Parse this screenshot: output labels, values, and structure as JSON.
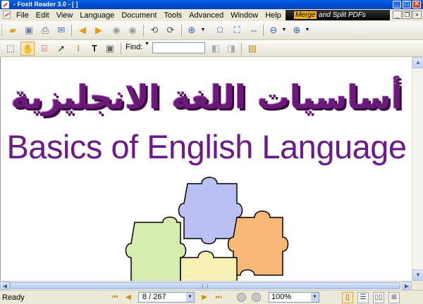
{
  "window": {
    "title": "- Foxit Reader 3.0 - [ ]"
  },
  "menu": [
    "File",
    "Edit",
    "View",
    "Language",
    "Document",
    "Tools",
    "Advanced",
    "Window",
    "Help"
  ],
  "ad": {
    "highlight": "Merge",
    "text": "and Split PDFs"
  },
  "toolbar1": {
    "buttons": [
      "open-folder-icon",
      "save-icon",
      "print-icon",
      "email-icon",
      "previous-page-icon",
      "next-page-icon",
      "go-back-icon",
      "go-forward-icon",
      "rotate-left-icon",
      "rotate-right-icon",
      "zoom-in-tool-icon",
      "actual-size-icon",
      "fit-page-icon",
      "fit-width-icon",
      "zoom-out-icon",
      "zoom-in-icon"
    ]
  },
  "toolbar2": {
    "find_label": "Find:",
    "find_value": "",
    "buttons": [
      "select-text-icon",
      "hand-tool-icon",
      "snapshot-icon",
      "pointer-icon",
      "text-selection-icon",
      "typewriter-icon",
      "image-icon"
    ]
  },
  "document": {
    "arabic_title": "أساسيات اللغة الانجليزية",
    "english_title": "Basics of English Language"
  },
  "status": {
    "text": "Ready",
    "page_display": "8 / 267",
    "current_page": 8,
    "total_pages": 267,
    "zoom": "100%"
  },
  "colors": {
    "title_purple": "#6b1b87",
    "accent_blue": "#0050d8"
  }
}
